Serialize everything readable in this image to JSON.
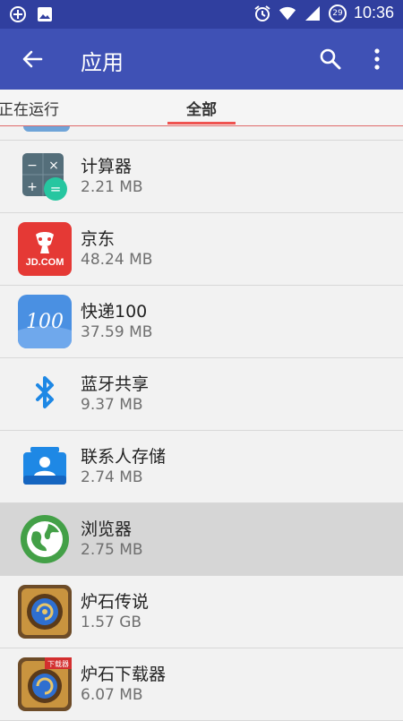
{
  "status_bar": {
    "time": "10:36",
    "battery_level": "29"
  },
  "app_bar": {
    "title": "应用"
  },
  "tabs": [
    {
      "label": "正在运行",
      "active": false
    },
    {
      "label": "全部",
      "active": true
    }
  ],
  "apps": [
    {
      "name": "计算器",
      "size": "2.21 MB",
      "icon": "calculator-icon"
    },
    {
      "name": "京东",
      "size": "48.24 MB",
      "icon": "jd-icon"
    },
    {
      "name": "快递100",
      "size": "37.59 MB",
      "icon": "kuaidi100-icon"
    },
    {
      "name": "蓝牙共享",
      "size": "9.37 MB",
      "icon": "bluetooth-icon"
    },
    {
      "name": "联系人存储",
      "size": "2.74 MB",
      "icon": "contacts-storage-icon"
    },
    {
      "name": "浏览器",
      "size": "2.75 MB",
      "icon": "browser-icon",
      "selected": true
    },
    {
      "name": "炉石传说",
      "size": "1.57 GB",
      "icon": "hearthstone-icon"
    },
    {
      "name": "炉石下载器",
      "size": "6.07 MB",
      "icon": "hearthstone-downloader-icon"
    }
  ],
  "icon_text": {
    "calc_minus": "−",
    "calc_times": "×",
    "calc_plus": "+",
    "calc_equals": "=",
    "jd_logo": "JD.COM",
    "kuaidi_logo": "100",
    "hs_badge": "下载器"
  },
  "colors": {
    "status_bar": "#303f9f",
    "app_bar": "#3f51b5",
    "tab_indicator": "#ef5350",
    "selected_row": "#d6d6d6"
  }
}
